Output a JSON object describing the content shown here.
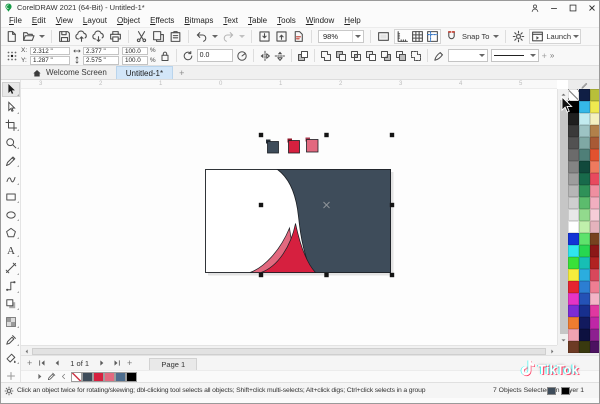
{
  "window": {
    "title": "CorelDRAW 2021 (64-Bit) - Untitled-1*"
  },
  "menu_bar": {
    "items": [
      "File",
      "Edit",
      "View",
      "Layout",
      "Object",
      "Effects",
      "Bitmaps",
      "Text",
      "Table",
      "Tools",
      "Window",
      "Help"
    ]
  },
  "standard_toolbar": {
    "zoom_value": "98%",
    "snap_to_label": "Snap To",
    "launch_label": "Launch"
  },
  "property_bar": {
    "x_label": "X:",
    "y_label": "Y:",
    "x_value": "2.312 \"",
    "y_value": "1.287 \"",
    "width_value": "2.377 \"",
    "height_value": "2.575 \"",
    "scale_h": "100.0",
    "scale_v": "100.0",
    "percent_h": "%",
    "percent_v": "%",
    "angle_value": "0.0",
    "plus_glyph": "+",
    "overflow_glyph": "»"
  },
  "document_tabs": {
    "welcome_label": "Welcome Screen",
    "active_doc_label": "Untitled-1*",
    "new_tab_glyph": "+"
  },
  "rulers": {
    "horizontal_labels": [
      "3",
      "2",
      "1",
      "0",
      "1",
      "2",
      "3",
      "4",
      "5"
    ],
    "vertical_labels": [
      "1",
      "0",
      "1",
      "2"
    ]
  },
  "toolbox": {
    "tools": [
      "pick-tool",
      "shape-tool",
      "crop-tool",
      "zoom-tool",
      "freehand-tool",
      "artistic-media-tool",
      "rectangle-tool",
      "ellipse-tool",
      "polygon-tool",
      "text-tool",
      "dimension-tool",
      "connector-tool",
      "drop-shadow-tool",
      "transparency-tool",
      "eyedropper-tool",
      "interactive-fill-tool",
      "add-tool"
    ]
  },
  "artwork": {
    "card_fill": "#ffffff",
    "dark_fill": "#3e4c5a",
    "red_fill": "#d6203f",
    "rose_fill": "#e2697f",
    "outline": "#1b1f24",
    "swatches": [
      {
        "fill": "#3e4c5a",
        "tab": "#262f38"
      },
      {
        "fill": "#d6203f",
        "tab": "#8e1528"
      },
      {
        "fill": "#e2697f",
        "tab": "#a93a50"
      }
    ]
  },
  "page_bar": {
    "add_glyph": "+",
    "page_indicator": "1 of 1",
    "add_glyph2": "+",
    "page_tab_label": "Page 1"
  },
  "document_palette": {
    "colors": [
      "none",
      "#3e4c5a",
      "#d6203f",
      "#e2697f",
      "#4d6d8e",
      "#000000"
    ]
  },
  "status_bar": {
    "hint": "Click an object twice for rotating/skewing; dbl-clicking tool selects all objects; Shift+click multi-selects; Alt+click digs; Ctrl+click selects in a group",
    "selection_info": "7 Objects Selected on Layer 1"
  },
  "watermark": {
    "label": "TikTok"
  },
  "color_palette": {
    "rows": [
      [
        "none",
        "#101f45",
        "#b8bf3a"
      ],
      [
        "#000000",
        "#35b8e8",
        "#efe94f"
      ],
      [
        "#1f1f1f",
        "#c2ebf0",
        "#f4f0c0"
      ],
      [
        "#3a3a3a",
        "#9dc3c4",
        "#b1804a"
      ],
      [
        "#525252",
        "#7fa8a4",
        "#a85a35"
      ],
      [
        "#6b6b6b",
        "#4f7f78",
        "#e2522f"
      ],
      [
        "#848484",
        "#11493c",
        "#ee7a5e"
      ],
      [
        "#9d9d9d",
        "#186a4b",
        "#e84a5e"
      ],
      [
        "#b6b6b6",
        "#2f9158",
        "#ef8fa0"
      ],
      [
        "#cfcfcf",
        "#5cbc6d",
        "#f2afc0"
      ],
      [
        "#e8e8e8",
        "#92da8d",
        "#f5ccd7"
      ],
      [
        "#ffffff",
        "#c0f0ab",
        "#e5b3bd"
      ],
      [
        "#1333d6",
        "#5ee26c",
        "#77421f"
      ],
      [
        "#2fe5ee",
        "#27d650",
        "#8c1717"
      ],
      [
        "#39e139",
        "#17bfb4",
        "#b12222"
      ],
      [
        "#f4ec3c",
        "#2badde",
        "#d8485b"
      ],
      [
        "#e62430",
        "#2c7ed2",
        "#ee7e92"
      ],
      [
        "#e634c6",
        "#2452b6",
        "#f3b4c6"
      ],
      [
        "#7c2cd6",
        "#172f8d",
        "#e038a0"
      ],
      [
        "#ee7c30",
        "#121a5e",
        "#bf27a6"
      ],
      [
        "#f0a2b2",
        "#0d1140",
        "#8d2090"
      ],
      [
        "#6d3b24",
        "#39390f",
        "#4c1261"
      ]
    ]
  }
}
